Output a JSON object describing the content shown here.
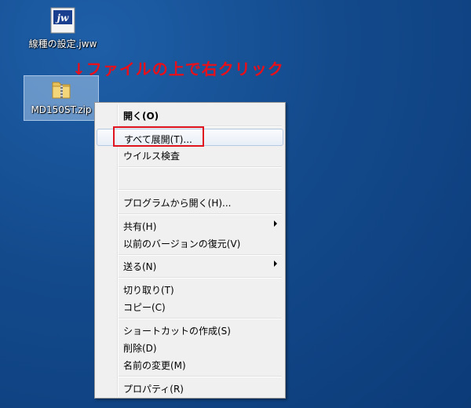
{
  "desktop": {
    "icons": [
      {
        "label": "線種の設定.jww"
      },
      {
        "label": "MD150ST.zip"
      }
    ]
  },
  "annotation": "↓ファイルの上で右クリック",
  "context_menu": {
    "items": [
      {
        "label": "開く(O)"
      },
      {
        "label": "すべて展開(T)..."
      },
      {
        "label": "ウイルス検査"
      },
      {
        "label": "プログラムから開く(H)..."
      },
      {
        "label": "共有(H)"
      },
      {
        "label": "以前のバージョンの復元(V)"
      },
      {
        "label": "送る(N)"
      },
      {
        "label": "切り取り(T)"
      },
      {
        "label": "コピー(C)"
      },
      {
        "label": "ショートカットの作成(S)"
      },
      {
        "label": "削除(D)"
      },
      {
        "label": "名前の変更(M)"
      },
      {
        "label": "プロパティ(R)"
      }
    ]
  },
  "colors": {
    "annotation": "#e8101a",
    "highlight": "#e0141e",
    "desktop": "#134a8c"
  }
}
